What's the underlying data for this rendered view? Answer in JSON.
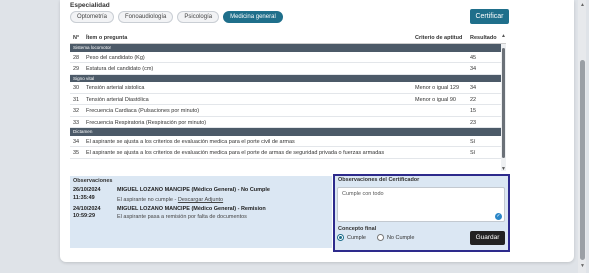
{
  "especialidad": {
    "label": "Especialidad",
    "tabs": [
      {
        "label": "Optometría",
        "active": false
      },
      {
        "label": "Fonoaudiología",
        "active": false
      },
      {
        "label": "Psicología",
        "active": false
      },
      {
        "label": "Medicina general",
        "active": true
      }
    ]
  },
  "certify_button": "Certificar",
  "table": {
    "headers": {
      "num": "N°",
      "item": "Ítem o pregunta",
      "criterio": "Criterio de aptitud",
      "resultado": "Resultado"
    },
    "rows": [
      {
        "type": "section",
        "label": "Sistema locomotor"
      },
      {
        "type": "row",
        "num": "28",
        "item": "Peso del candidato (Kg)",
        "criterio": "",
        "resultado": "45"
      },
      {
        "type": "row",
        "num": "29",
        "item": "Estatura del candidato (cm)",
        "criterio": "",
        "resultado": "34"
      },
      {
        "type": "section",
        "label": "Signo vital"
      },
      {
        "type": "row",
        "num": "30",
        "item": "Tensión arterial sistolica",
        "criterio": "Menor o igual 129",
        "resultado": "34"
      },
      {
        "type": "row",
        "num": "31",
        "item": "Tensión arterial Diastólica",
        "criterio": "Menor o igual 90",
        "resultado": "22"
      },
      {
        "type": "row",
        "num": "32",
        "item": "Frecuencia Cardiaca (Pulsaciones por minuto)",
        "criterio": "",
        "resultado": "15"
      },
      {
        "type": "row",
        "num": "33",
        "item": "Frecuencia Respiratoria (Respiración por minuto)",
        "criterio": "",
        "resultado": "23"
      },
      {
        "type": "section",
        "label": "Dictamen"
      },
      {
        "type": "row",
        "num": "34",
        "item": "El aspirante se ajusta a los criterios de evaluación medica para el porte civil de armas",
        "criterio": "",
        "resultado": "Sí"
      },
      {
        "type": "row",
        "num": "35",
        "item": "El aspirante se ajusta a los criterios de evaluación medica para el porte de armas de seguridad privada o fuerzas armadas",
        "criterio": "",
        "resultado": "Sí"
      }
    ]
  },
  "observaciones": {
    "title": "Observaciones",
    "entries": [
      {
        "date": "26/10/2024",
        "time": "11:35:49",
        "head": "MIGUEL LOZANO MANCIPE (Médico General) - No Cumple",
        "text": "El aspirante no cumple - ",
        "link": "Descargar Adjunto"
      },
      {
        "date": "24/10/2024",
        "time": "10:59:29",
        "head": "MIGUEL LOZANO MANCIPE (Médico General) - Remision",
        "text": "El aspirante pasa a remisión por falta de documentos",
        "link": ""
      }
    ]
  },
  "certificador": {
    "title": "Observaciones del Certificador",
    "textarea_value": "Cumple con todo",
    "concepto_title": "Concepto final",
    "options": [
      {
        "label": "Cumple",
        "selected": true
      },
      {
        "label": "No Cumple",
        "selected": false
      }
    ],
    "save_button": "Guardar"
  },
  "colors": {
    "accent": "#1f6f8b",
    "section_bg": "#4c5a68",
    "panel_bg": "#dbe7f3",
    "highlight_border": "#2d2a8c"
  }
}
